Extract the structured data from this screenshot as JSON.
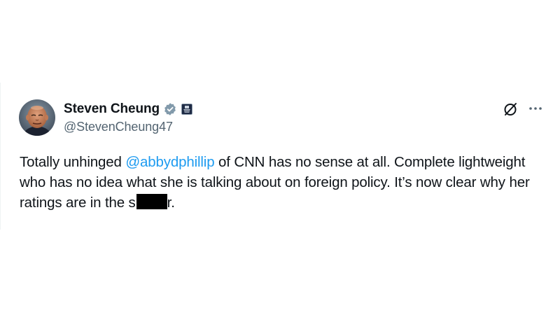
{
  "author": {
    "display_name": "Steven Cheung",
    "handle": "@StevenCheung47",
    "verified_icon": "verified-badge-icon",
    "affiliate_icon": "affiliate-badge-icon",
    "avatar_icon": "profile-photo-avatar"
  },
  "actions": {
    "grok_icon": "grok-icon",
    "more_icon": "more-options-icon"
  },
  "tweet": {
    "text_part1": "Totally unhinged ",
    "mention": "@abbydphillip",
    "text_part2": " of CNN has no sense at all. Complete lightweight who has no idea what she is talking about on foreign policy. It’s now clear why her ratings are in the s",
    "text_part3": "r."
  },
  "colors": {
    "link": "#1d9bf0",
    "verified": "#829aab",
    "secondary_text": "#536471",
    "primary_text": "#0f1419"
  }
}
